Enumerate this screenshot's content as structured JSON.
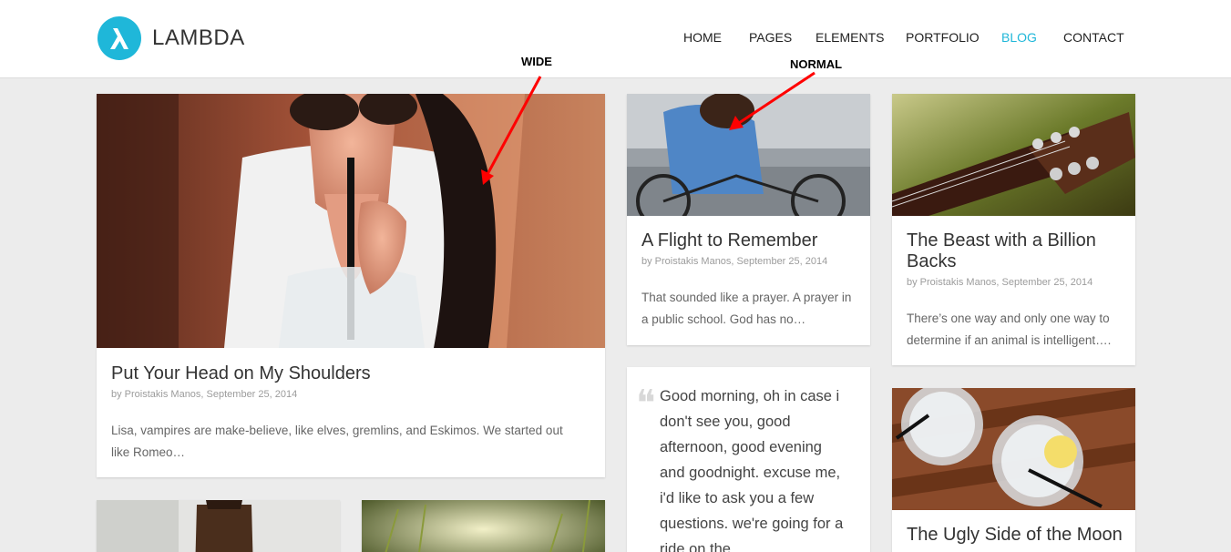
{
  "brand": {
    "name": "LAMBDA",
    "accent": "#1fb7d9"
  },
  "nav": {
    "items": [
      {
        "label": "HOME"
      },
      {
        "label": "PAGES"
      },
      {
        "label": "ELEMENTS"
      },
      {
        "label": "PORTFOLIO"
      },
      {
        "label": "BLOG",
        "active": true
      },
      {
        "label": "CONTACT"
      }
    ]
  },
  "annotations": {
    "wide": "WIDE",
    "normal": "NORMAL",
    "arrow_color": "#ff0000"
  },
  "posts": [
    {
      "title": "Put Your Head on My Shoulders",
      "meta": "by Proistakis Manos, September 25, 2014",
      "excerpt": "Lisa, vampires are make-believe, like elves, gremlins, and Eskimos. We started out like Romeo…"
    },
    {
      "title": "A Flight to Remember",
      "meta": "by Proistakis Manos, September 25, 2014",
      "excerpt": "That sounded like a prayer. A prayer in a public school. God has no…"
    },
    {
      "title": "The Beast with a Billion Backs",
      "meta": "by Proistakis Manos, September 25, 2014",
      "excerpt": "There’s one way and only one way to determine if an animal is intelligent…."
    },
    {
      "title": "The Ugly Side of the Moon"
    }
  ],
  "quote": {
    "text": "Good morning, oh in case i don't see you, good afternoon, good evening and goodnight. excuse me, i'd like to ask you a few questions. we're going for a ride on the"
  }
}
